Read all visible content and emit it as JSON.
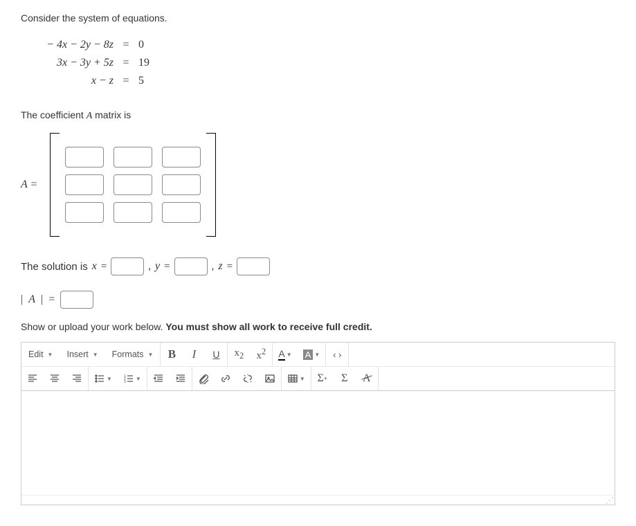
{
  "problem": {
    "intro": "Consider the system of equations.",
    "equations": [
      {
        "lhs": "− 4x − 2y − 8z",
        "rhs": "0"
      },
      {
        "lhs": "3x − 3y + 5z",
        "rhs": "19"
      },
      {
        "lhs": "x − z",
        "rhs": "5"
      }
    ],
    "equalsGlyph": "=",
    "coeff_label_pre": "The coefficient ",
    "coeff_label_var": "A",
    "coeff_label_post": " matrix is",
    "matrix_label": "A =",
    "solution_pre": "The solution is ",
    "vars": {
      "x": "x",
      "y": "y",
      "z": "z"
    },
    "comma": " , ",
    "eq": " = ",
    "det_label_open": "|",
    "det_label_var": "A",
    "det_label_close": "| ",
    "det_eq": "=",
    "instr_pre": "Show or upload your work below. ",
    "instr_bold": "You must show all work to receive full credit."
  },
  "editor": {
    "menus": {
      "edit": "Edit",
      "insert": "Insert",
      "formats": "Formats"
    },
    "buttons": {
      "bold": "B",
      "italic": "I",
      "underline": "U",
      "sub": "x",
      "sub2": "2",
      "sup": "x",
      "sup2": "2",
      "tcolor": "A",
      "bgcolor": "A",
      "code": "‹ ›",
      "sigma_plus": "Σ",
      "sigma": "Σ"
    }
  }
}
